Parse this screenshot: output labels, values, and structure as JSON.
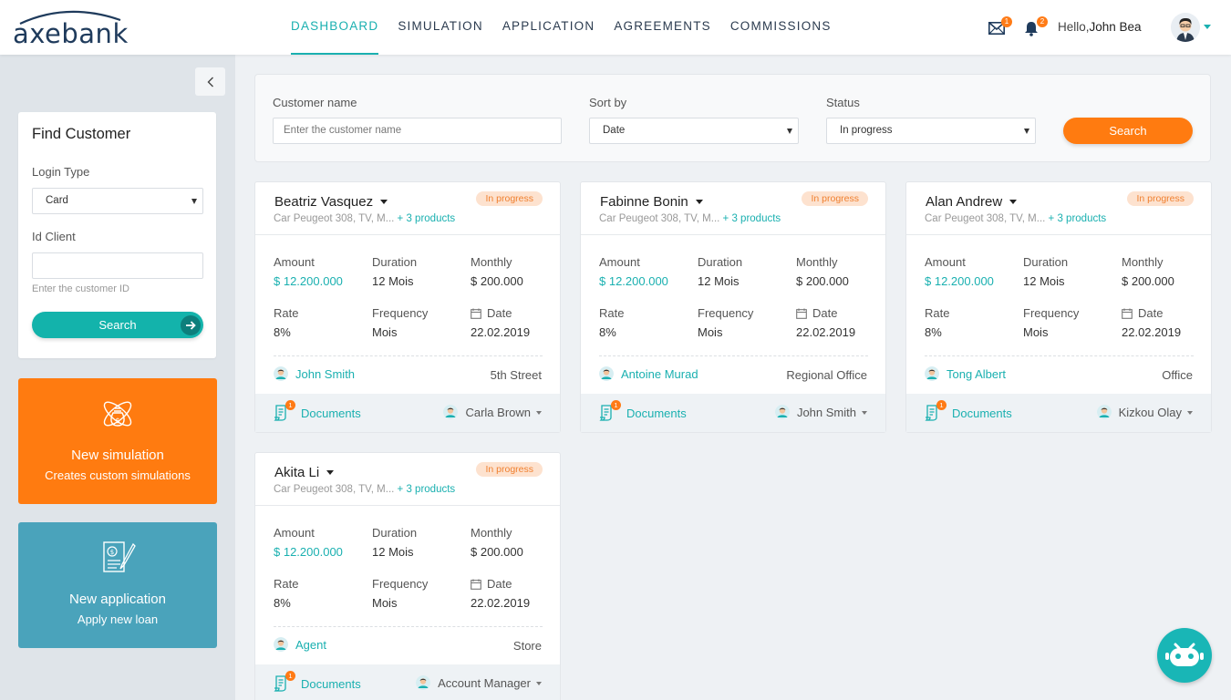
{
  "app": {
    "logo": "axebank"
  },
  "nav": [
    {
      "label": "DASHBOARD",
      "active": true
    },
    {
      "label": "SIMULATION"
    },
    {
      "label": "APPLICATION"
    },
    {
      "label": "AGREEMENTS"
    },
    {
      "label": "COMMISSIONS"
    }
  ],
  "header": {
    "mail_badge": "1",
    "bell_badge": "2",
    "hello": "Hello,",
    "user": "John Bea"
  },
  "find": {
    "title": "Find Customer",
    "login_type_label": "Login Type",
    "login_type_value": "Card",
    "id_label": "Id Client",
    "id_value": "",
    "id_hint": "Enter the customer ID",
    "search": "Search"
  },
  "tiles": {
    "sim_title": "New simulation",
    "sim_sub": "Creates custom simulations",
    "app_title": "New application",
    "app_sub": "Apply new loan"
  },
  "filter": {
    "name_label": "Customer name",
    "name_placeholder": "Enter the customer name",
    "sort_label": "Sort by",
    "sort_value": "Date",
    "status_label": "Status",
    "status_value": "In progress",
    "search": "Search"
  },
  "labels": {
    "amount": "Amount",
    "duration": "Duration",
    "monthly": "Monthly",
    "rate": "Rate",
    "frequency": "Frequency",
    "date": "Date",
    "documents": "Documents"
  },
  "cards": [
    {
      "name": "Beatriz Vasquez",
      "status": "In progress",
      "products": "Car Peugeot 308, TV, M...",
      "more": "+ 3 products",
      "amount": "$ 12.200.000",
      "duration": "12 Mois",
      "monthly": "$ 200.000",
      "rate": "8%",
      "frequency": "Mois",
      "date": "22.02.2019",
      "person": "John Smith",
      "place": "5th Street",
      "docs_badge": "1",
      "agent": "Carla Brown"
    },
    {
      "name": "Fabinne Bonin",
      "status": "In progress",
      "products": "Car Peugeot 308, TV, M...",
      "more": "+ 3 products",
      "amount": "$ 12.200.000",
      "duration": "12 Mois",
      "monthly": "$ 200.000",
      "rate": "8%",
      "frequency": "Mois",
      "date": "22.02.2019",
      "person": "Antoine Murad",
      "place": "Regional Office",
      "docs_badge": "1",
      "agent": "John Smith"
    },
    {
      "name": "Alan Andrew",
      "status": "In progress",
      "products": "Car Peugeot 308, TV, M...",
      "more": "+ 3 products",
      "amount": "$ 12.200.000",
      "duration": "12 Mois",
      "monthly": "$ 200.000",
      "rate": "8%",
      "frequency": "Mois",
      "date": "22.02.2019",
      "person": "Tong Albert",
      "place": "Office",
      "docs_badge": "1",
      "agent": "Kizkou Olay"
    },
    {
      "name": "Akita Li",
      "status": "In progress",
      "products": "Car Peugeot 308, TV, M...",
      "more": "+ 3 products",
      "amount": "$ 12.200.000",
      "duration": "12 Mois",
      "monthly": "$ 200.000",
      "rate": "8%",
      "frequency": "Mois",
      "date": "22.02.2019",
      "person": "Agent",
      "place": "Store",
      "docs_badge": "1",
      "agent": "Account Manager"
    }
  ],
  "colors": {
    "teal": "#1ab0b0",
    "orange": "#ff7b10",
    "blue_tile": "#4aa3bb",
    "navy": "#1f3b5c"
  }
}
